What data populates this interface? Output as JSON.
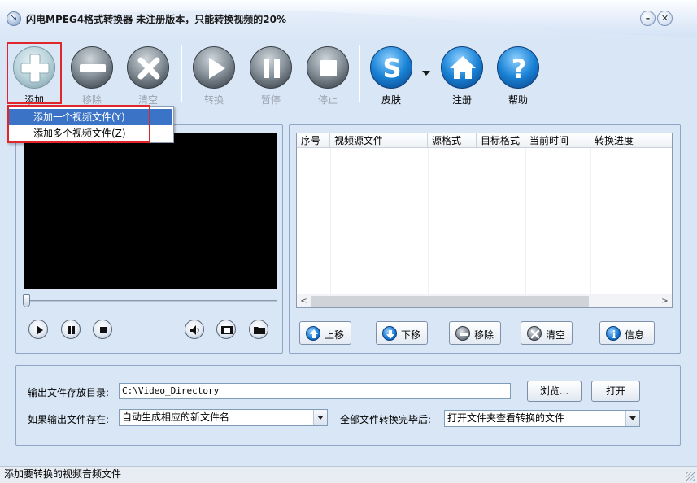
{
  "window": {
    "title": "闪电MPEG4格式转换器  未注册版本，只能转换视频的20%",
    "minimize_glyph": "–",
    "close_glyph": "✕"
  },
  "toolbar": {
    "add": "添加",
    "remove": "移除",
    "clear": "清空",
    "convert": "转换",
    "pause": "暂停",
    "stop": "停止",
    "skin": "皮肤",
    "register": "注册",
    "help": "帮助"
  },
  "add_menu": {
    "items": [
      "添加一个视频文件(Y)",
      "添加多个视频文件(Z)"
    ]
  },
  "file_table": {
    "columns": [
      "序号",
      "视频源文件",
      "源格式",
      "目标格式",
      "当前时间",
      "转换进度"
    ],
    "rows": []
  },
  "list_buttons": {
    "up": "上移",
    "down": "下移",
    "remove": "移除",
    "clear": "清空",
    "info": "信息"
  },
  "output": {
    "dir_label": "输出文件存放目录:",
    "dir_value": "C:\\Video_Directory",
    "browse": "浏览...",
    "open": "打开",
    "exists_label": "如果输出文件存在:",
    "exists_value": "自动生成相应的新文件名",
    "after_label": "全部文件转换完毕后:",
    "after_value": "打开文件夹查看转换的文件"
  },
  "status": {
    "text": "添加要转换的视频音频文件"
  },
  "colors": {
    "accent_red": "#e0262b",
    "menu_selection": "#3b73c7",
    "window_bg": "#d9e6f5"
  }
}
